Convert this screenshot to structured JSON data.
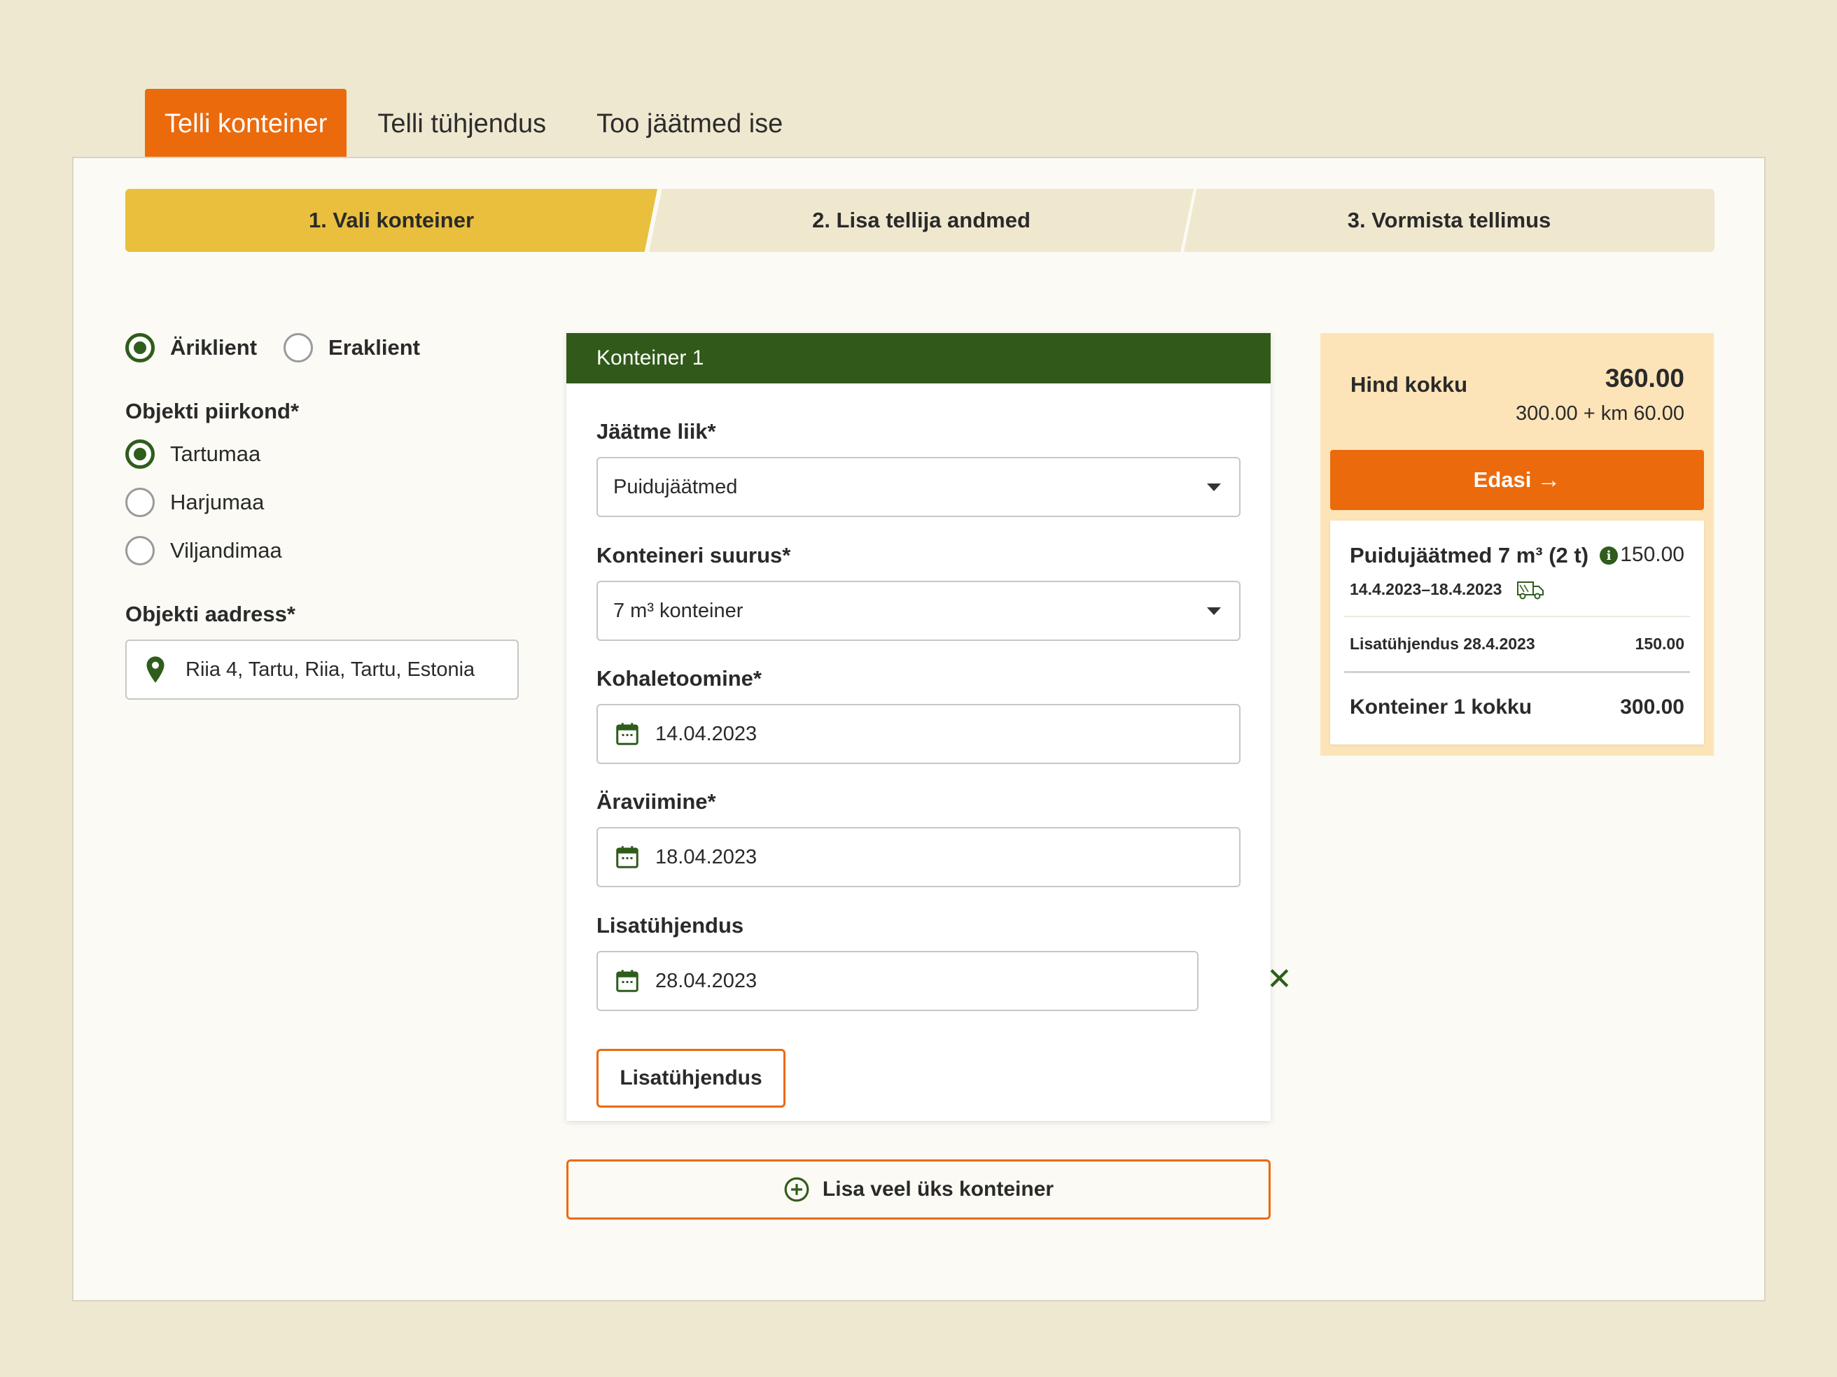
{
  "tabs": [
    {
      "label": "Telli konteiner",
      "active": true
    },
    {
      "label": "Telli tühjendus",
      "active": false
    },
    {
      "label": "Too jäätmed ise",
      "active": false
    }
  ],
  "steps": [
    {
      "label": "1. Vali konteiner",
      "active": true
    },
    {
      "label": "2. Lisa tellija andmed",
      "active": false
    },
    {
      "label": "3. Vormista tellimus",
      "active": false
    }
  ],
  "client_type": {
    "options": [
      "Äriklient",
      "Eraklient"
    ],
    "selected": "Äriklient"
  },
  "region": {
    "label": "Objekti piirkond*",
    "options": [
      "Tartumaa",
      "Harjumaa",
      "Viljandimaa"
    ],
    "selected": "Tartumaa"
  },
  "address": {
    "label": "Objekti aadress*",
    "value": "Riia 4, Tartu, Riia, Tartu, Estonia"
  },
  "container": {
    "title": "Konteiner 1",
    "waste_type": {
      "label": "Jäätme liik*",
      "value": "Puidujäätmed"
    },
    "size": {
      "label": "Konteineri suurus*",
      "value": "7 m³ konteiner"
    },
    "delivery": {
      "label": "Kohaletoomine*",
      "value": "14.04.2023"
    },
    "pickup": {
      "label": "Äraviimine*",
      "value": "18.04.2023"
    },
    "extra_emptying": {
      "label": "Lisatühjendus",
      "value": "28.04.2023"
    },
    "extra_button": "Lisatühjendus"
  },
  "add_container_label": "Lisa veel üks konteiner",
  "summary": {
    "title": "Hind kokku",
    "total": "360.00",
    "breakdown": "300.00 + km 60.00",
    "next_button": "Edasi",
    "item": {
      "name": "Puidujäätmed 7 m³ (2 t)",
      "price": "150.00",
      "dates": "14.4.2023–18.4.2023"
    },
    "extra": {
      "label": "Lisatühjendus 28.4.2023",
      "price": "150.00"
    },
    "container_total": {
      "label": "Konteiner 1 kokku",
      "price": "300.00"
    }
  },
  "colors": {
    "accent": "#eb6a0c",
    "brand_green": "#315a1a",
    "step_active": "#e9bf3d",
    "summary_bg": "#fde4b8",
    "page_bg": "#efe8d0"
  }
}
